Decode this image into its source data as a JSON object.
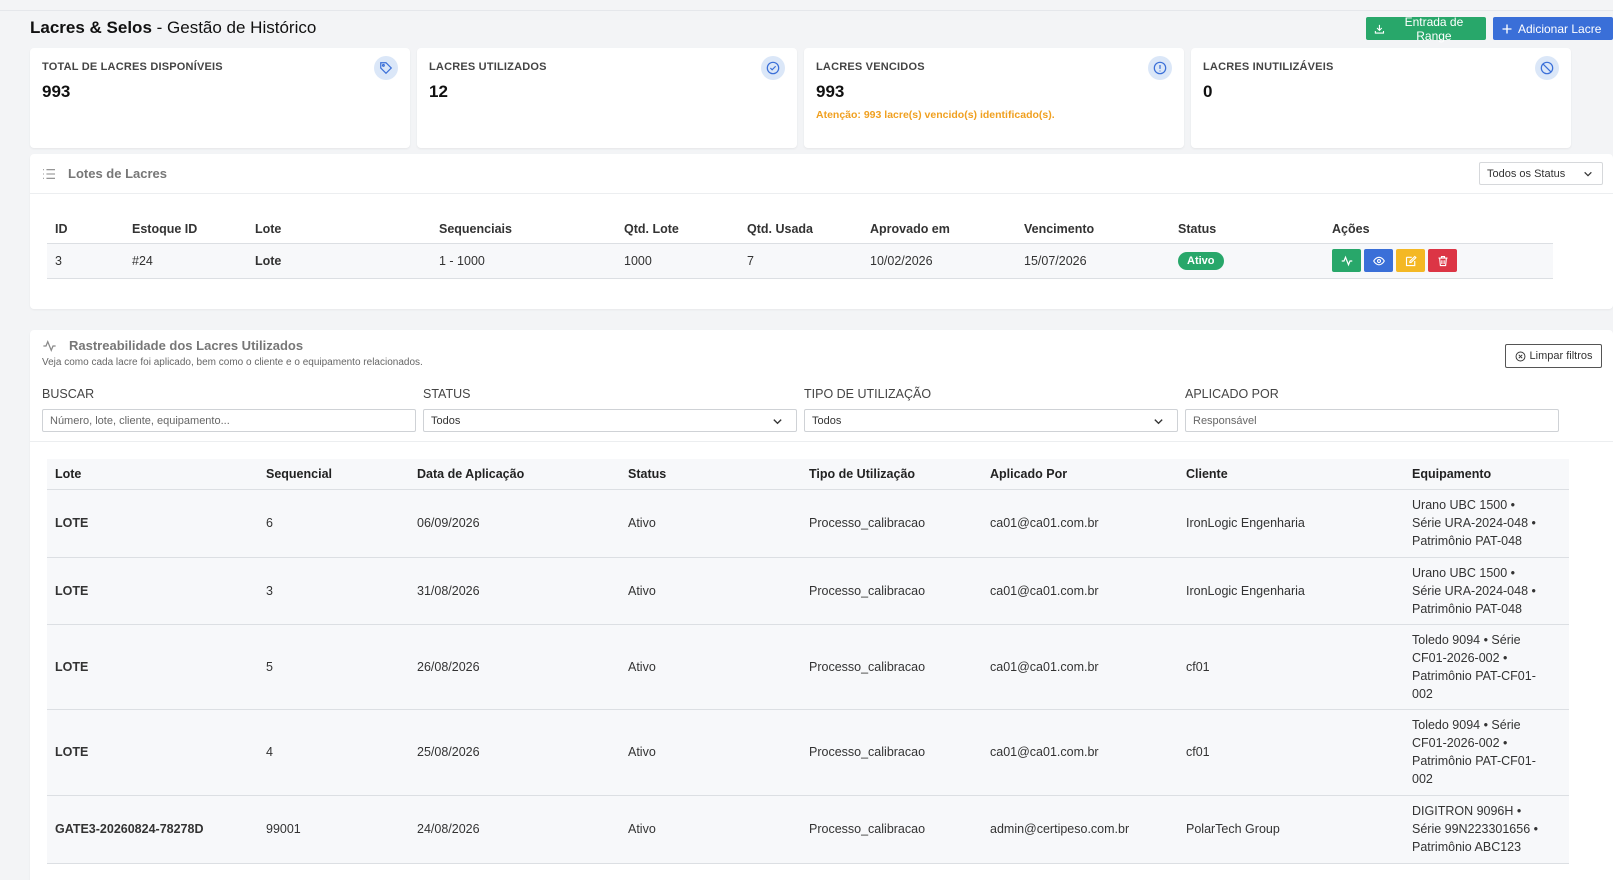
{
  "header": {
    "title_bold": "Lacres & Selos",
    "title_rest": " - Gestão de Histórico",
    "btn_range": "Entrada de Range",
    "btn_add": "Adicionar Lacre"
  },
  "cards": [
    {
      "label": "TOTAL DE LACRES DISPONÍVEIS",
      "value": "993",
      "icon": "tag-icon"
    },
    {
      "label": "LACRES UTILIZADOS",
      "value": "12",
      "icon": "check-circle-icon"
    },
    {
      "label": "LACRES VENCIDOS",
      "value": "993",
      "note": "Atenção: 993 lacre(s) vencido(s) identificado(s).",
      "icon": "info-icon"
    },
    {
      "label": "LACRES INUTILIZÁVEIS",
      "value": "0",
      "icon": "ban-icon"
    }
  ],
  "lotes": {
    "title": "Lotes de Lacres",
    "status_filter": "Todos os Status",
    "columns": [
      "ID",
      "Estoque ID",
      "Lote",
      "Sequenciais",
      "Qtd. Lote",
      "Qtd. Usada",
      "Aprovado em",
      "Vencimento",
      "Status",
      "Ações"
    ],
    "rows": [
      {
        "id": "3",
        "estoque": "#24",
        "lote": "Lote",
        "seq": "1 - 1000",
        "qtd_lote": "1000",
        "qtd_usada": "7",
        "aprovado": "10/02/2026",
        "vencimento": "15/07/2026",
        "status": "Ativo"
      }
    ]
  },
  "rastreabilidade": {
    "title": "Rastreabilidade dos Lacres Utilizados",
    "subtitle": "Veja como cada lacre foi aplicado, bem como o cliente e o equipamento relacionados.",
    "clear_filters": "Limpar filtros",
    "filters": {
      "buscar_label": "BUSCAR",
      "buscar_placeholder": "Número, lote, cliente, equipamento...",
      "status_label": "STATUS",
      "status_value": "Todos",
      "tipo_label": "TIPO DE UTILIZAÇÃO",
      "tipo_value": "Todos",
      "aplicado_label": "APLICADO POR",
      "aplicado_placeholder": "Responsável"
    },
    "columns": [
      "Lote",
      "Sequencial",
      "Data de Aplicação",
      "Status",
      "Tipo de Utilização",
      "Aplicado Por",
      "Cliente",
      "Equipamento"
    ],
    "rows": [
      {
        "lote": "LOTE",
        "seq": "6",
        "data": "06/09/2026",
        "status": "Ativo",
        "tipo": "Processo_calibracao",
        "aplicado": "ca01@ca01.com.br",
        "cliente": "IronLogic Engenharia",
        "equip": [
          "Urano UBC 1500 •",
          "Série URA-2024-048 •",
          "Patrimônio PAT-048"
        ]
      },
      {
        "lote": "LOTE",
        "seq": "3",
        "data": "31/08/2026",
        "status": "Ativo",
        "tipo": "Processo_calibracao",
        "aplicado": "ca01@ca01.com.br",
        "cliente": "IronLogic Engenharia",
        "equip": [
          "Urano UBC 1500 •",
          "Série URA-2024-048 •",
          "Patrimônio PAT-048"
        ]
      },
      {
        "lote": "LOTE",
        "seq": "5",
        "data": "26/08/2026",
        "status": "Ativo",
        "tipo": "Processo_calibracao",
        "aplicado": "ca01@ca01.com.br",
        "cliente": "cf01",
        "equip": [
          "Toledo 9094 • Série",
          "CF01-2026-002 •",
          "Patrimônio PAT-CF01-",
          "002"
        ]
      },
      {
        "lote": "LOTE",
        "seq": "4",
        "data": "25/08/2026",
        "status": "Ativo",
        "tipo": "Processo_calibracao",
        "aplicado": "ca01@ca01.com.br",
        "cliente": "cf01",
        "equip": [
          "Toledo 9094 • Série",
          "CF01-2026-002 •",
          "Patrimônio PAT-CF01-",
          "002"
        ]
      },
      {
        "lote": "GATE3-20260824-78278D",
        "seq": "99001",
        "data": "24/08/2026",
        "status": "Ativo",
        "tipo": "Processo_calibracao",
        "aplicado": "admin@certipeso.com.br",
        "cliente": "PolarTech Group",
        "equip": [
          "DIGITRON 9096H •",
          "Série 99N223301656 •",
          "Patrimônio ABC123"
        ]
      }
    ]
  },
  "colors": {
    "green": "#28a76a",
    "blue": "#3a6fd8",
    "yellow": "#f4b824",
    "red": "#dc3545",
    "warning": "#f0a020"
  }
}
